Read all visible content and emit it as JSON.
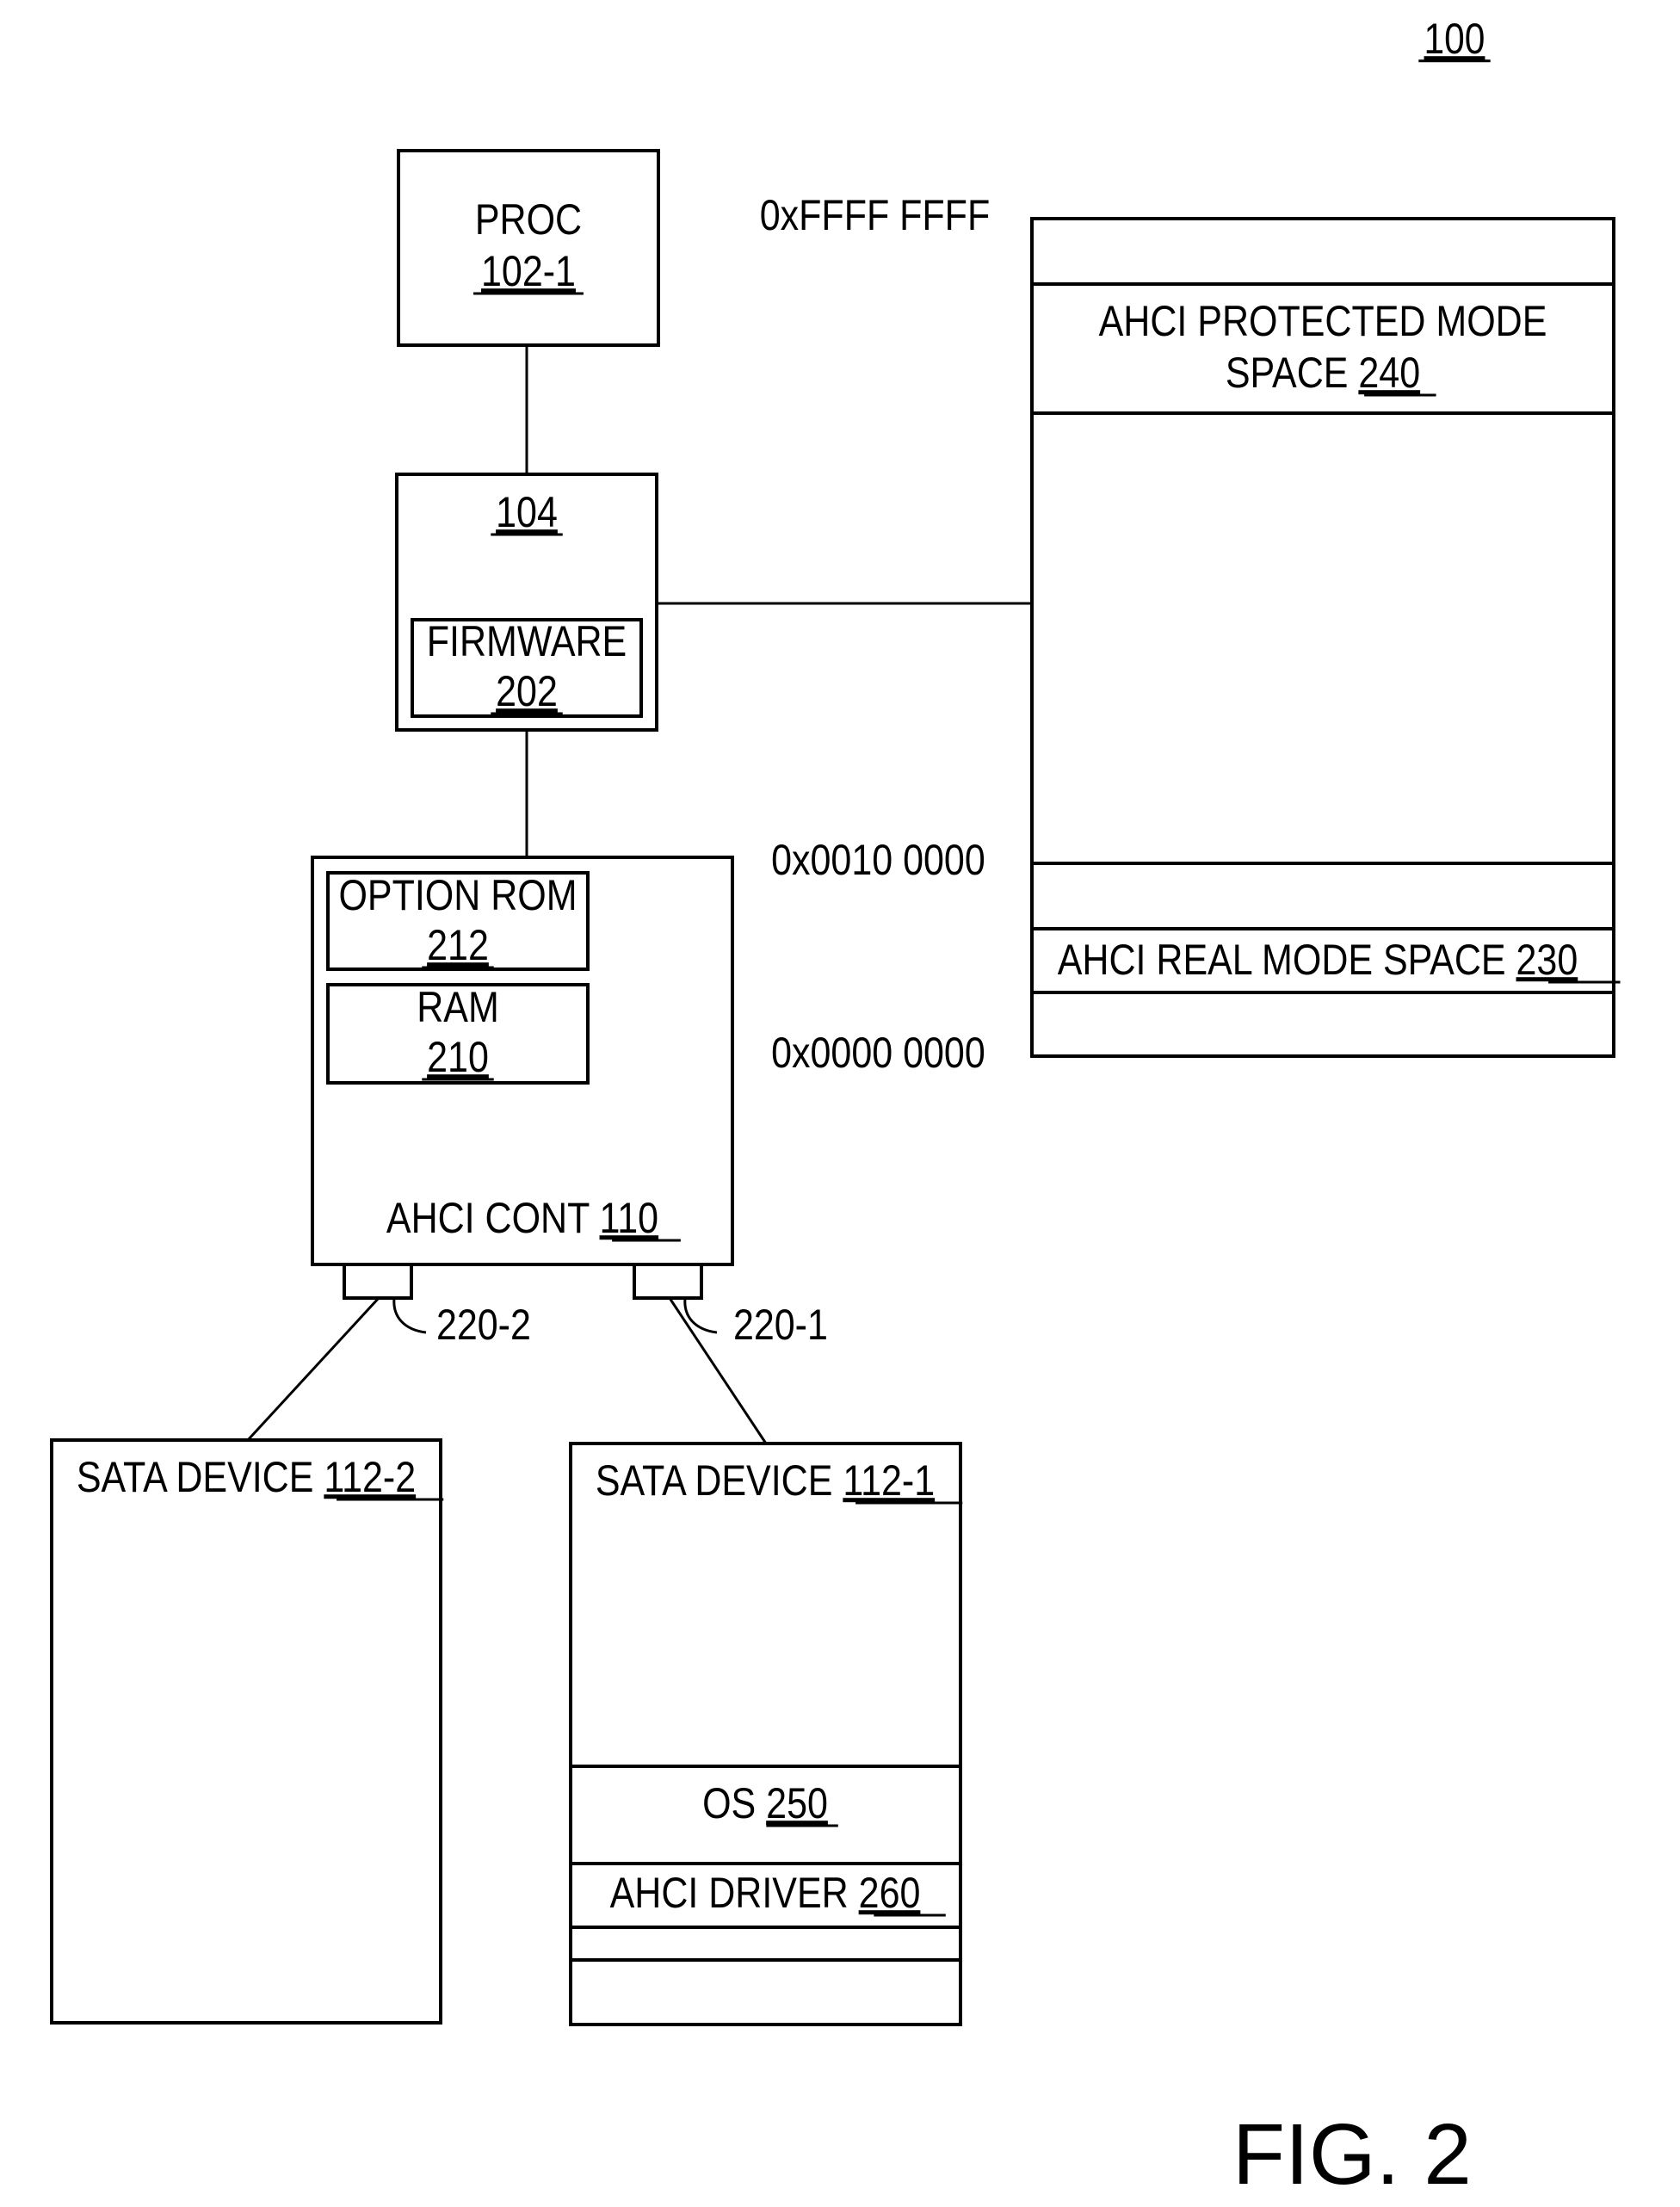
{
  "figure": {
    "ref_number": "100",
    "caption": "FIG. 2",
    "line_color": "#000000",
    "background": "#ffffff"
  },
  "blocks": {
    "proc": {
      "title": "PROC",
      "ref": "102-1"
    },
    "chipset": {
      "ref": "104"
    },
    "firmware": {
      "title": "FIRMWARE",
      "ref": "202"
    },
    "ahci_controller": {
      "title": "AHCI CONT ",
      "ref": "110"
    },
    "option_rom": {
      "title": "OPTION ROM",
      "ref": "212"
    },
    "ram": {
      "title": "RAM",
      "ref": "210"
    },
    "port_2": {
      "ref": "220-2"
    },
    "port_1": {
      "ref": "220-1"
    },
    "sata_device_2": {
      "title": "SATA DEVICE ",
      "ref": "112-2"
    },
    "sata_device_1": {
      "title": "SATA DEVICE ",
      "ref": "112-1"
    },
    "os": {
      "title": "OS ",
      "ref": "250"
    },
    "ahci_driver": {
      "title": "AHCI DRIVER ",
      "ref": "260"
    }
  },
  "memory_map": {
    "top_address": "0xFFFF FFFF",
    "mid_address": "0x0010 0000",
    "bottom_address": "0x0000 0000",
    "protected_mode": {
      "title_line1": "AHCI PROTECTED MODE",
      "title_line2": "SPACE ",
      "ref": "240"
    },
    "real_mode": {
      "title": "AHCI REAL MODE SPACE ",
      "ref": "230"
    }
  }
}
